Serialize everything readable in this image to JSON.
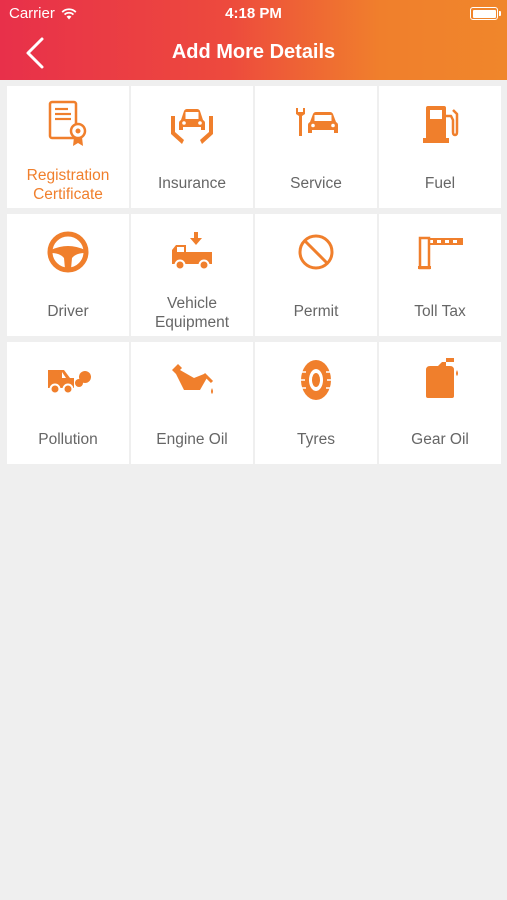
{
  "status": {
    "carrier": "Carrier",
    "time": "4:18 PM"
  },
  "nav": {
    "title": "Add More Details"
  },
  "colors": {
    "accent": "#f07f2c",
    "header_start": "#e8304a",
    "header_end": "#f0862b",
    "label": "#666666",
    "background": "#efefef"
  },
  "tiles": [
    {
      "label": "Registration Certificate",
      "icon": "certificate-icon"
    },
    {
      "label": "Insurance",
      "icon": "car-insurance-icon"
    },
    {
      "label": "Service",
      "icon": "car-service-icon"
    },
    {
      "label": "Fuel",
      "icon": "fuel-pump-icon"
    },
    {
      "label": "Driver",
      "icon": "steering-wheel-icon"
    },
    {
      "label": "Vehicle Equipment",
      "icon": "tow-truck-icon"
    },
    {
      "label": "Permit",
      "icon": "prohibited-icon"
    },
    {
      "label": "Toll Tax",
      "icon": "toll-barrier-icon"
    },
    {
      "label": "Pollution",
      "icon": "car-exhaust-icon"
    },
    {
      "label": "Engine Oil",
      "icon": "oil-can-icon"
    },
    {
      "label": "Tyres",
      "icon": "tyre-icon"
    },
    {
      "label": "Gear Oil",
      "icon": "oil-jerrycan-icon"
    }
  ]
}
